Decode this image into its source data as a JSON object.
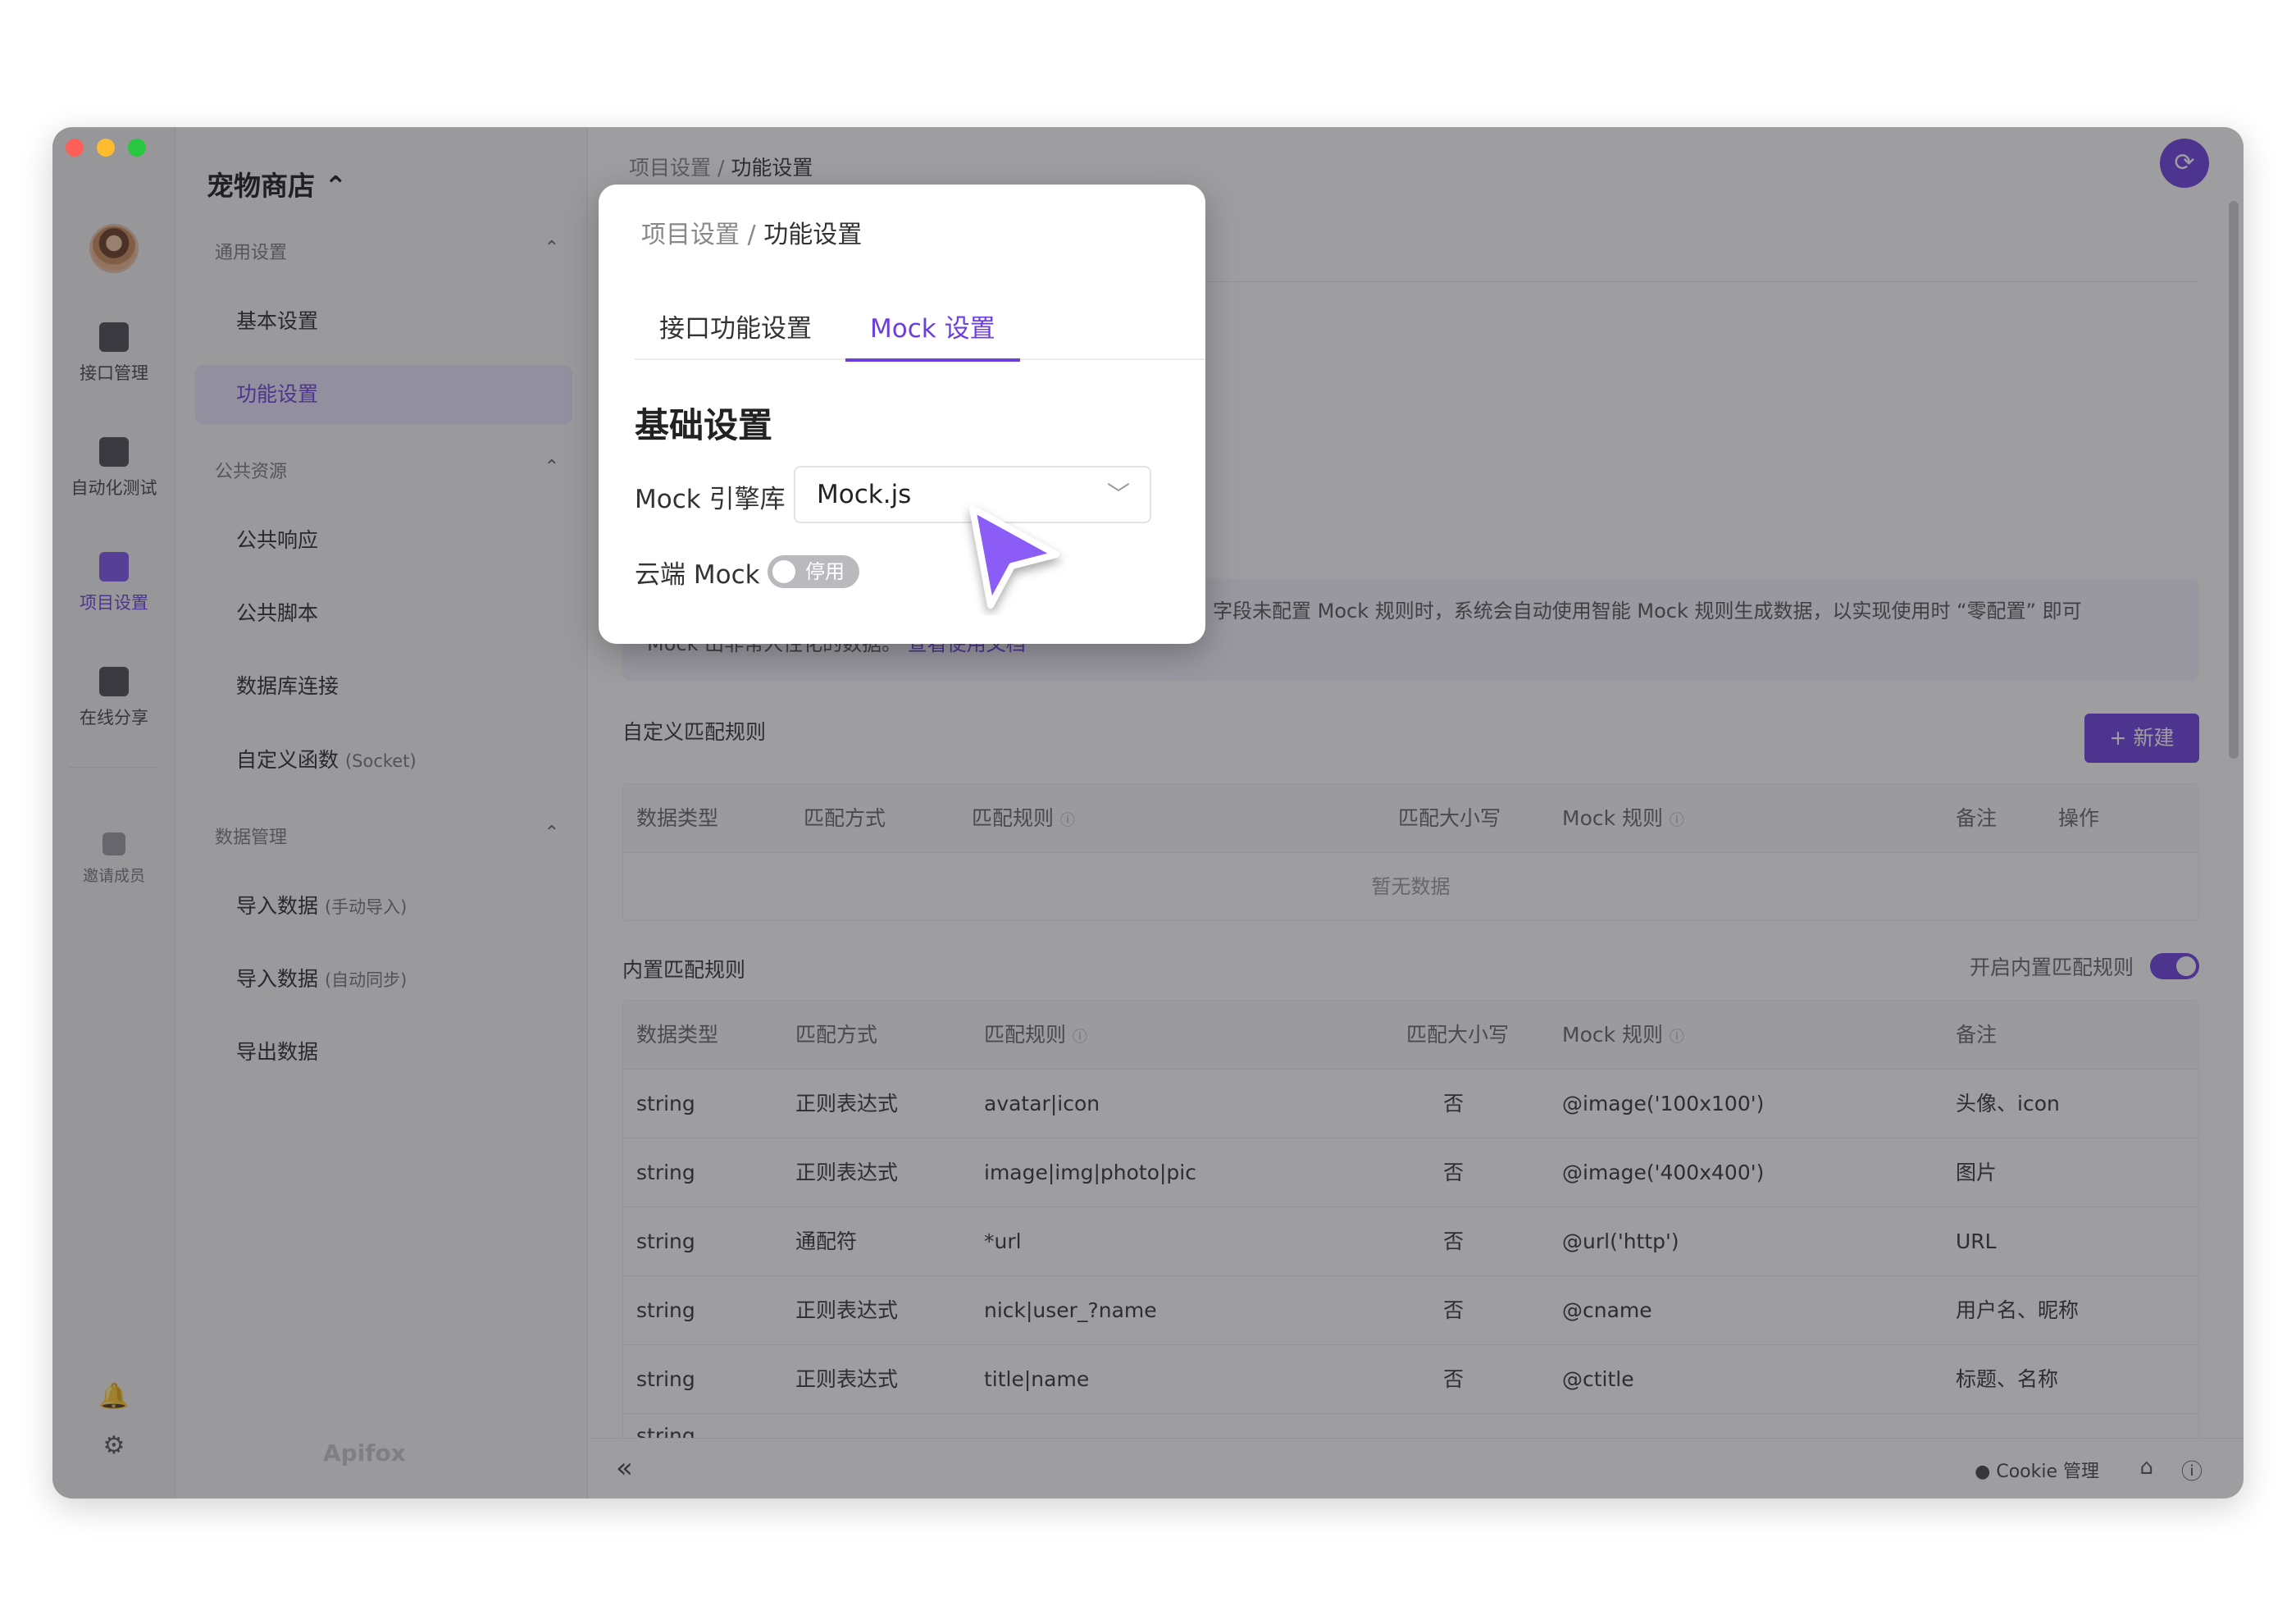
{
  "sidebar_rail": {
    "items": [
      {
        "label": "接口管理",
        "icon": "api-icon"
      },
      {
        "label": "自动化测试",
        "icon": "test-icon"
      },
      {
        "label": "项目设置",
        "icon": "settings-project-icon"
      },
      {
        "label": "在线分享",
        "icon": "share-icon"
      },
      {
        "label": "邀请成员",
        "icon": "invite-icon"
      }
    ]
  },
  "sidebar": {
    "project_name": "宠物商店 ⌃",
    "groups": [
      {
        "title": "通用设置",
        "items": [
          "基本设置",
          "功能设置"
        ]
      },
      {
        "title": "公共资源",
        "items": [
          "公共响应",
          "公共脚本",
          "数据库连接",
          "自定义函数"
        ]
      },
      {
        "title": "数据管理",
        "items": [
          "导入数据",
          "导入数据",
          "导出数据"
        ]
      }
    ],
    "custom_fn_suffix": "(Socket)",
    "import_manual_suffix": "(手动导入)",
    "import_auto_suffix": "(自动同步)",
    "watermark": "Apifox"
  },
  "main": {
    "breadcrumb_root": "项目设置",
    "breadcrumb_sep": "/",
    "breadcrumb_current": "功能设置",
    "info_text": "字段未配置 Mock 规则时，系统会自动使用智能 Mock 规则生成数据，以实现使用时 “零配置” 即可",
    "info_text2": "Mock 出非常人性化的数据。",
    "info_link": "查看使用文档",
    "custom_rules_title": "自定义匹配规则",
    "new_button": "+ 新建",
    "custom_headers": [
      "数据类型",
      "匹配方式",
      "匹配规则",
      "匹配大小写",
      "Mock 规则",
      "备注",
      "操作"
    ],
    "empty_text": "暂无数据",
    "builtin_title": "内置匹配规则",
    "builtin_toggle_label": "开启内置匹配规则",
    "builtin_headers": [
      "数据类型",
      "匹配方式",
      "匹配规则",
      "匹配大小写",
      "Mock 规则",
      "备注"
    ],
    "builtin_rows": [
      [
        "string",
        "正则表达式",
        "avatar|icon",
        "否",
        "@image('100x100')",
        "头像、icon"
      ],
      [
        "string",
        "正则表达式",
        "image|img|photo|pic",
        "否",
        "@image('400x400')",
        "图片"
      ],
      [
        "string",
        "通配符",
        "*url",
        "否",
        "@url('http')",
        "URL"
      ],
      [
        "string",
        "正则表达式",
        "nick|user_?name",
        "否",
        "@cname",
        "用户名、昵称"
      ],
      [
        "string",
        "正则表达式",
        "title|name",
        "否",
        "@ctitle",
        "标题、名称"
      ],
      [
        "string",
        "",
        "",
        "",
        "",
        ""
      ]
    ]
  },
  "footer": {
    "collapse": "«",
    "cookie": "Cookie 管理"
  },
  "popup": {
    "breadcrumb_root": "项目设置",
    "breadcrumb_sep": "/",
    "breadcrumb_current": "功能设置",
    "tabs": [
      "接口功能设置",
      "Mock 设置"
    ],
    "active_tab": 1,
    "section_title": "基础设置",
    "engine_label": "Mock 引擎库",
    "engine_value": "Mock.js",
    "cloud_label": "云端 Mock",
    "cloud_switch_text": "停用"
  },
  "colors": {
    "accent": "#6b3ee0",
    "overlay": "rgba(40,40,44,0.45)"
  }
}
